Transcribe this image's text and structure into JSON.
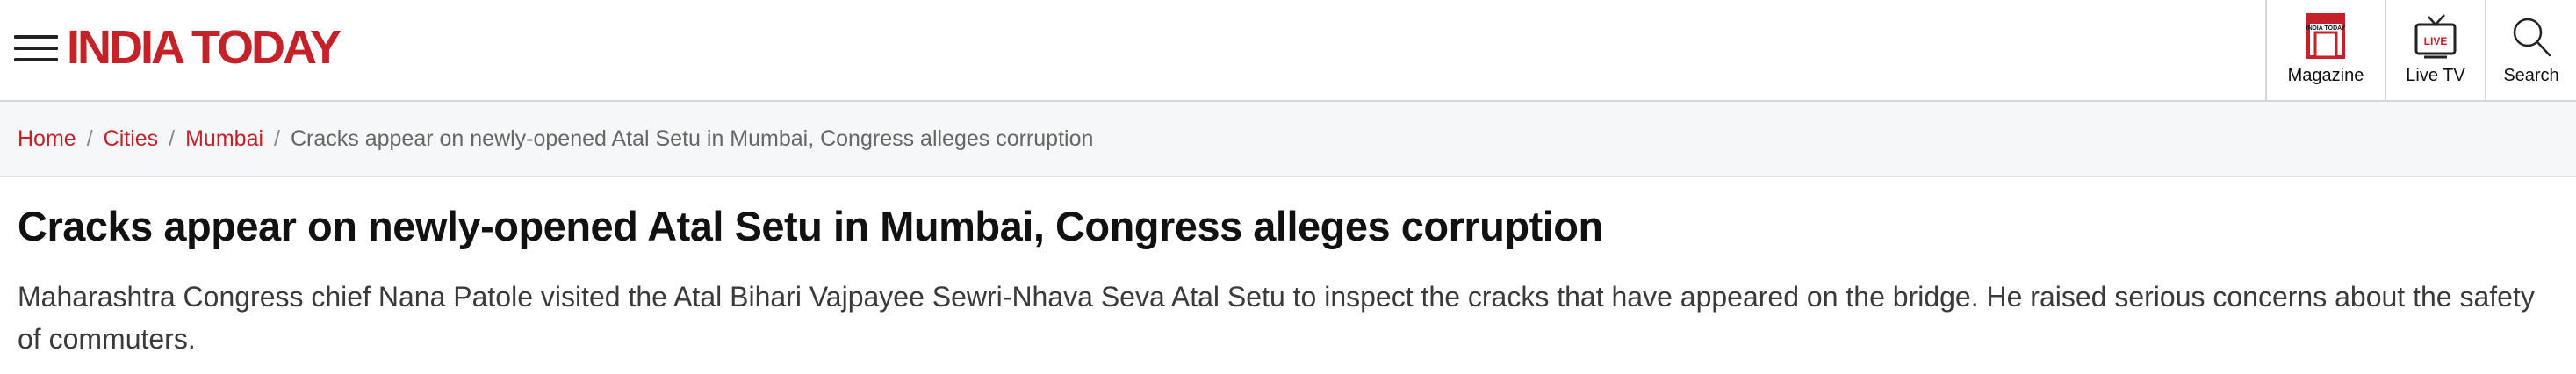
{
  "header": {
    "menu_icon": "hamburger-menu-icon",
    "logo_text": "INDIA TODAY",
    "brand_color": "#c42129",
    "magazine": {
      "icon": "magazine-icon",
      "icon_text": "INDIA TODAY",
      "label": "Magazine"
    },
    "live_tv": {
      "icon": "tv-icon",
      "icon_text": "LIVE",
      "label": "Live TV"
    },
    "search": {
      "icon": "search-icon",
      "label": "Search"
    }
  },
  "breadcrumb": {
    "items": [
      "Home",
      "Cities",
      "Mumbai"
    ],
    "separator": "/",
    "current": "Cracks appear on newly-opened Atal Setu in Mumbai, Congress alleges corruption"
  },
  "article": {
    "title": "Cracks appear on newly-opened Atal Setu in Mumbai, Congress alleges corruption",
    "summary": "Maharashtra Congress chief Nana Patole visited the Atal Bihari Vajpayee Sewri-Nhava Seva Atal Setu to inspect the cracks that have appeared on the bridge. He raised serious concerns about the safety of commuters."
  }
}
